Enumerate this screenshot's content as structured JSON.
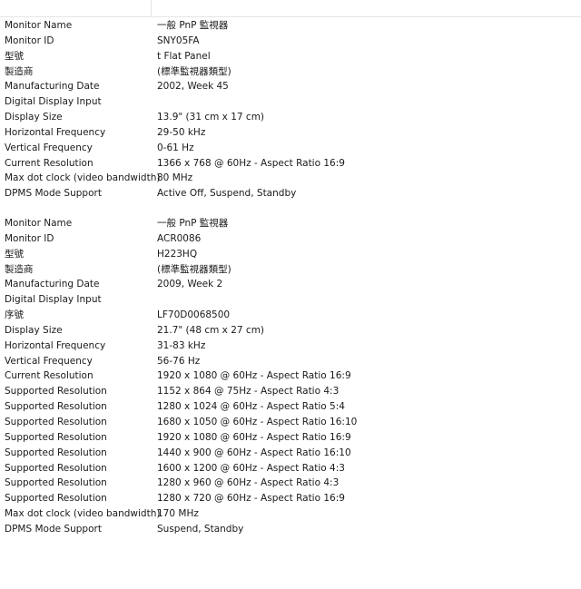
{
  "sections": [
    {
      "rows": [
        {
          "label": "Monitor Name",
          "value": "一般 PnP 監視器"
        },
        {
          "label": "Monitor ID",
          "value": "SNY05FA"
        },
        {
          "label": "型號",
          "value": "t Flat Panel"
        },
        {
          "label": "製造商",
          "value": "(標準監視器類型)"
        },
        {
          "label": "Manufacturing Date",
          "value": "2002, Week 45"
        },
        {
          "label": "Digital Display Input",
          "value": ""
        },
        {
          "label": "Display Size",
          "value": "13.9\" (31 cm x 17 cm)"
        },
        {
          "label": "Horizontal Frequency",
          "value": "29-50 kHz"
        },
        {
          "label": "Vertical Frequency",
          "value": "0-61 Hz"
        },
        {
          "label": "Current Resolution",
          "value": "1366 x 768 @ 60Hz - Aspect Ratio 16:9"
        },
        {
          "label": "Max dot clock (video bandwidth)",
          "value": "80 MHz"
        },
        {
          "label": "DPMS Mode Support",
          "value": "Active Off, Suspend, Standby"
        }
      ]
    },
    {
      "rows": [
        {
          "label": "Monitor Name",
          "value": "一般 PnP 監視器"
        },
        {
          "label": "Monitor ID",
          "value": "ACR0086"
        },
        {
          "label": "型號",
          "value": "H223HQ"
        },
        {
          "label": "製造商",
          "value": "(標準監視器類型)"
        },
        {
          "label": "Manufacturing Date",
          "value": "2009, Week 2"
        },
        {
          "label": "Digital Display Input",
          "value": ""
        },
        {
          "label": "序號",
          "value": "LF70D0068500"
        },
        {
          "label": "Display Size",
          "value": "21.7\" (48 cm x 27 cm)"
        },
        {
          "label": "Horizontal Frequency",
          "value": "31-83 kHz"
        },
        {
          "label": "Vertical Frequency",
          "value": "56-76 Hz"
        },
        {
          "label": "Current Resolution",
          "value": "1920 x 1080 @ 60Hz - Aspect Ratio 16:9"
        },
        {
          "label": "Supported Resolution",
          "value": "1152 x 864 @ 75Hz - Aspect Ratio 4:3"
        },
        {
          "label": "Supported Resolution",
          "value": "1280 x 1024 @ 60Hz - Aspect Ratio 5:4"
        },
        {
          "label": "Supported Resolution",
          "value": "1680 x 1050 @ 60Hz - Aspect Ratio 16:10"
        },
        {
          "label": "Supported Resolution",
          "value": "1920 x 1080 @ 60Hz - Aspect Ratio 16:9"
        },
        {
          "label": "Supported Resolution",
          "value": "1440 x 900 @ 60Hz - Aspect Ratio 16:10"
        },
        {
          "label": "Supported Resolution",
          "value": "1600 x 1200 @ 60Hz - Aspect Ratio 4:3"
        },
        {
          "label": "Supported Resolution",
          "value": "1280 x 960 @ 60Hz - Aspect Ratio 4:3"
        },
        {
          "label": "Supported Resolution",
          "value": "1280 x 720 @ 60Hz - Aspect Ratio 16:9"
        },
        {
          "label": "Max dot clock (video bandwidth)",
          "value": "170 MHz"
        },
        {
          "label": "DPMS Mode Support",
          "value": "Suspend, Standby"
        }
      ]
    }
  ]
}
